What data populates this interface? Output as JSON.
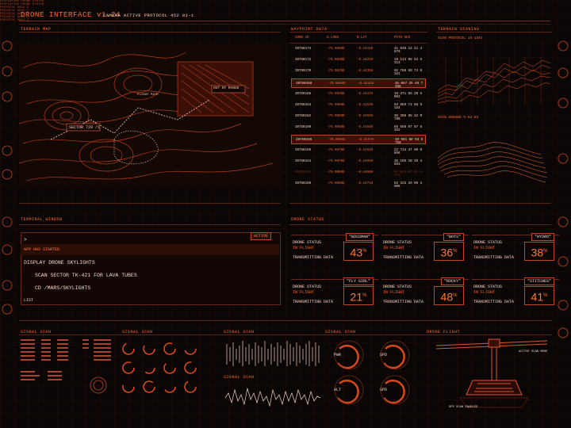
{
  "header": {
    "title": "DRONE INTERFACE v1.24",
    "subtitle": "CAMERA ACTIVE PROTOCOL 452 81-1"
  },
  "terrain_map": {
    "title": "TERRAIN MAP",
    "status": "DISPLAYING DRONE STATUS",
    "labels": [
      "SECTOR 720 /1",
      "FLIGHT PATH",
      "OUT OF RANGE"
    ]
  },
  "waypoint": {
    "title": "WAYPOINT DATA",
    "status": "DISPLAYING DRONE STATUS",
    "columns": [
      "CORD ID",
      "E.LONG",
      "N.LAT",
      "PATH GEO"
    ],
    "rows": [
      [
        "39750174",
        "-79.0080E",
        "-8.4415H",
        "41 938 12 21 4 679"
      ],
      [
        "39750172",
        "-79.0030E",
        "-8.4425H",
        "18 114 05 54 5 313"
      ],
      [
        "39750170",
        "-79.0035E",
        "-8.4435H",
        "02 768 69 74 0 161"
      ],
      [
        "39750168",
        "-79.0040E",
        "-8.4444H",
        "35 067 25 49 7 488"
      ],
      [
        "39750166",
        "-79.0045E",
        "-8.4447H",
        "18 371 55 20 5 003"
      ],
      [
        "39750164",
        "-79.0050E",
        "-8.4453H",
        "93 899 73 88 9 154"
      ],
      [
        "39750162",
        "-79.0055E",
        "-8.4455H",
        "35 396 85 42 0 796"
      ],
      [
        "39750160",
        "-79.0060E",
        "-8.4456H",
        "86 558 07 87 5 452"
      ],
      [
        "39750158",
        "-79.0065E",
        "-8.4457H",
        "38 581 88 63 9 750"
      ],
      [
        "39750156",
        "-79.0070E",
        "-8.4463H",
        "22 714 37 90 0 856"
      ],
      [
        "39750154",
        "-79.0075E",
        "-8.4465H",
        "35 195 18 45 4 563"
      ],
      [
        "39750152",
        "-79.0080E",
        "-8.4468H",
        "02 863 67 21 3 072"
      ],
      [
        "39750150",
        "-79.0085E",
        "-8.4471H",
        "62 315 29 09 4 606"
      ]
    ]
  },
  "terrain_scan": {
    "title": "TERRAIN SCANING",
    "protocol": "SCAN PROTOCOL 15-1591",
    "scan_ground": "SCAN GROUND 5-62 82"
  },
  "terminal": {
    "title": "TERMINAL WINDOW",
    "active": "ACTIVE",
    "prompt": ">",
    "line1": "APP HAS STARTED",
    "line2": "DISPLAY DRONE SKYLIGHTS",
    "line3": "SCAN SECTOR TK-421 FOR LAVA TUBES",
    "line4": "CD /MARS/SKYLIGHTS",
    "line5": "LIST"
  },
  "drone_status": {
    "title": "DRONE STATUS",
    "cards": [
      {
        "label": "DRONE STATUS",
        "state": "IN FLIGHT",
        "name": "\"BOSSMAN\"",
        "pct": "43",
        "tx": "TRANSMITTING DATA"
      },
      {
        "label": "DRONE STATUS",
        "state": "IN FLIGHT",
        "name": "\"BOTS\"",
        "pct": "36",
        "tx": "TRANSMITTING DATA"
      },
      {
        "label": "DRONE STATUS",
        "state": "IN FLIGHT",
        "name": "\"HYDRO\"",
        "pct": "38",
        "tx": "TRANSMITTING DATA"
      },
      {
        "label": "DRONE STATUS",
        "state": "IN FLIGHT",
        "name": "\"FLY GIRL\"",
        "pct": "21",
        "tx": "TRANSMITTING DATA"
      },
      {
        "label": "DRONE STATUS",
        "state": "IN FLIGHT",
        "name": "\"ROCKY\"",
        "pct": "48",
        "tx": "TRANSMITTING DATA"
      },
      {
        "label": "DRONE STATUS",
        "state": "IN FLIGHT",
        "name": "\"STITCHES\"",
        "pct": "41",
        "tx": "TRANSMITTING DATA"
      }
    ]
  },
  "signal": {
    "title": "SIGNAL SCAN",
    "protocol": "PROTOCOL 8084 I"
  },
  "drone_flight": {
    "title": "DRONE FLIGHT",
    "active_scan": "ACTIVE SCAN MODE",
    "gps": "GPS SCAN ENABLED"
  },
  "gauges": [
    "PWR",
    "SPD",
    "ALT",
    "SPD"
  ],
  "colors": {
    "accent": "#ff6a2a",
    "bg": "#0a0605",
    "line": "#6a2a16"
  }
}
